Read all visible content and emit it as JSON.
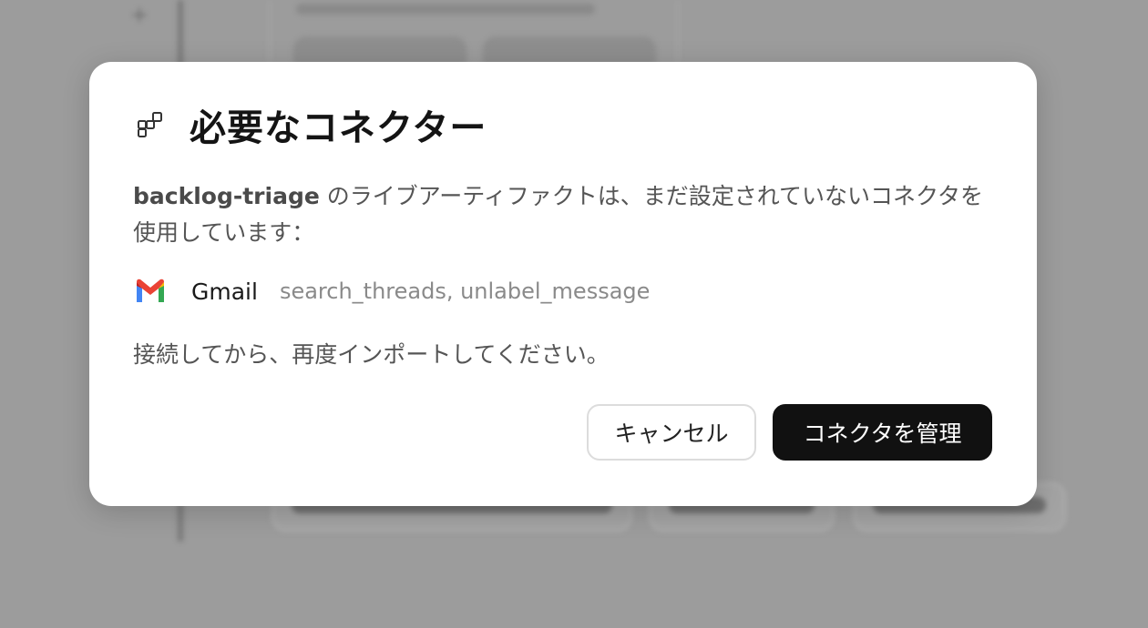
{
  "dialog": {
    "title": "必要なコネクター",
    "artifact_name": "backlog-triage",
    "description_rest": " のライブアーティファクトは、まだ設定されていないコネクタを使用しています：",
    "connector": {
      "icon": "gmail-icon",
      "name": "Gmail",
      "tools": "search_threads, unlabel_message"
    },
    "instruction": "接続してから、再度インポートしてください。",
    "cancel_label": "キャンセル",
    "manage_label": "コネクタを管理"
  },
  "colors": {
    "overlay": "#9c9c9c",
    "primary_button": "#111111",
    "gmail_red": "#EA4335",
    "gmail_blue": "#4285F4",
    "gmail_green": "#34A853",
    "gmail_yellow": "#FBBC04"
  }
}
